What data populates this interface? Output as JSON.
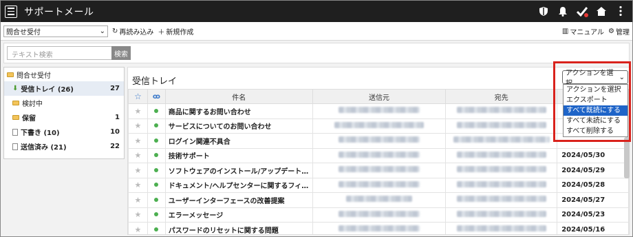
{
  "app": {
    "title": "サポートメール"
  },
  "toolbar": {
    "folder_select": "問合せ受付",
    "reload_label": "再読み込み",
    "new_label": "新規作成",
    "manual_label": "マニュアル",
    "admin_label": "管理"
  },
  "search": {
    "placeholder": "テキスト検索",
    "button_label": "検索"
  },
  "sidebar": {
    "root_label": "問合せ受付",
    "items": [
      {
        "label": "受信トレイ (26)",
        "count": "27"
      },
      {
        "label": "検討中",
        "count": ""
      },
      {
        "label": "保留",
        "count": "1"
      },
      {
        "label": "下書き (10)",
        "count": "10"
      },
      {
        "label": "送信済み (21)",
        "count": "22"
      }
    ]
  },
  "main": {
    "title": "受信トレイ",
    "columns": {
      "subject": "件名",
      "from": "送信元",
      "to": "宛先"
    },
    "rows": [
      {
        "subject": "商品に関するお問い合わせ",
        "date": ""
      },
      {
        "subject": "サービスについてのお問い合わせ",
        "date": ""
      },
      {
        "subject": "ログイン関連不具合",
        "date": ""
      },
      {
        "subject": "技術サポート",
        "date": "2024/05/30"
      },
      {
        "subject": "ソフトウェアのインストール/アップデート…",
        "date": "2024/05/29"
      },
      {
        "subject": "ドキュメント/ヘルプセンターに関するフィ…",
        "date": "2024/05/28"
      },
      {
        "subject": "ユーザーインターフェースの改善提案",
        "date": "2024/05/27"
      },
      {
        "subject": "エラーメッセージ",
        "date": "2024/05/23"
      },
      {
        "subject": "パスワードのリセットに関する問題",
        "date": "2024/05/16"
      }
    ]
  },
  "actions": {
    "selected": "アクションを選択",
    "options": [
      "アクションを選択",
      "エクスポート",
      "すべて既読にする",
      "すべて未読にする",
      "すべて削除する"
    ],
    "highlighted_index": 2
  },
  "colors": {
    "titlebar": "#1f1f1f",
    "highlight": "#d9221c",
    "selected_option": "#1e64c8",
    "unread_dot": "#4caf50"
  }
}
